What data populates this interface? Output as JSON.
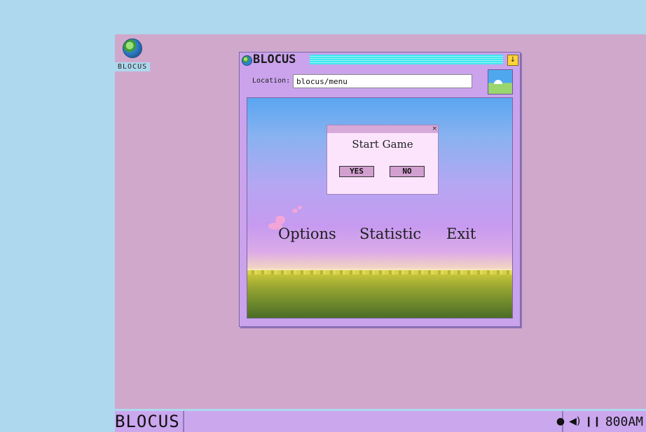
{
  "desktop": {
    "icon_label": "BLOCUS"
  },
  "window": {
    "title": "BLOCUS",
    "menu_button_symbol": "↓",
    "location_label": "Location:",
    "location_value": "blocus/menu"
  },
  "game": {
    "menu": {
      "options": "Options",
      "statistic": "Statistic",
      "exit": "Exit"
    },
    "dialog": {
      "close_symbol": "×",
      "title": "Start Game",
      "yes": "YES",
      "no": "NO"
    }
  },
  "taskbar": {
    "brand": "BLOCUS",
    "tray_icons": [
      "balloon-icon",
      "speaker-icon",
      "pause-icon"
    ],
    "time": "800AM"
  }
}
